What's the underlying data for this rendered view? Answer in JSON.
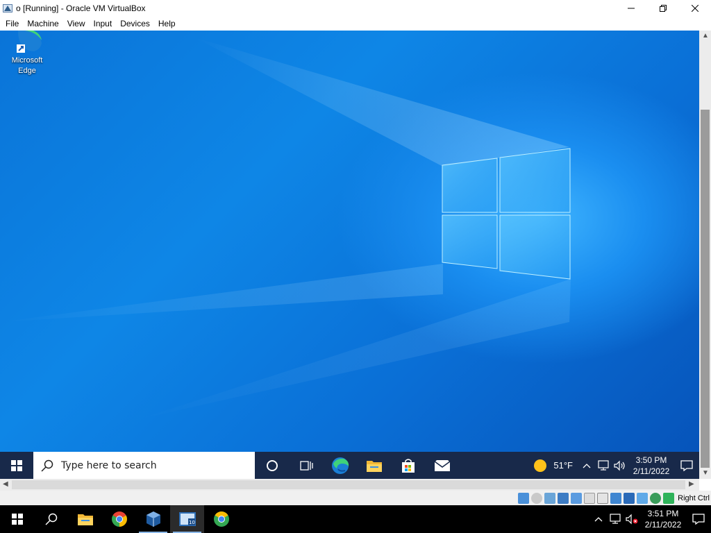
{
  "window": {
    "title": "o [Running] - Oracle VM VirtualBox",
    "app_icon": "virtualbox-icon"
  },
  "menubar": {
    "items": [
      "File",
      "Machine",
      "View",
      "Input",
      "Devices",
      "Help"
    ]
  },
  "desktop": {
    "icons": [
      {
        "label": "Microsoft Edge",
        "icon": "edge-shortcut-icon"
      }
    ]
  },
  "guest_taskbar": {
    "search_placeholder": "Type here to search",
    "pinned": [
      "cortana-icon",
      "task-view-icon",
      "edge-icon",
      "file-explorer-icon",
      "store-icon",
      "mail-icon"
    ],
    "weather_temp": "51°F",
    "time": "3:50 PM",
    "date": "2/11/2022"
  },
  "status_bar": {
    "host_key": "Right Ctrl"
  },
  "host_taskbar": {
    "pinned": [
      "file-explorer-icon",
      "chrome-icon",
      "virtualbox-icon",
      "win10-vm-icon",
      "chrome-alt-icon"
    ],
    "time": "3:51 PM",
    "date": "2/11/2022"
  },
  "colors": {
    "guest_taskbar": "#18294a",
    "desktop_blue": "#0a74d8",
    "host_taskbar": "#000000"
  }
}
